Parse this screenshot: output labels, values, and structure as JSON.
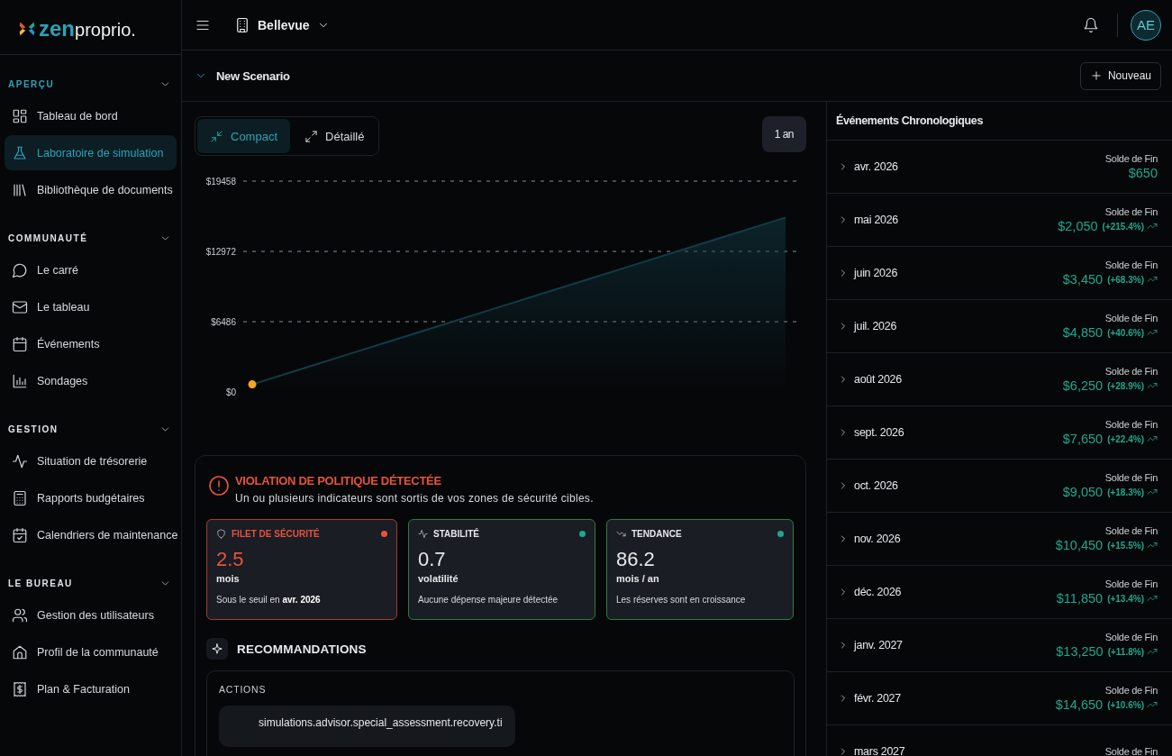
{
  "logo": {
    "part_1": "zen",
    "part_2": "proprio",
    "part_3": "."
  },
  "sidebar": {
    "sections": [
      {
        "title": "APERÇU",
        "expanded": true,
        "items": [
          {
            "label": "Tableau de bord",
            "selected": false
          },
          {
            "label": "Laboratoire de simulation",
            "selected": true
          },
          {
            "label": "Bibliothèque de documents",
            "selected": false
          }
        ]
      },
      {
        "title": "COMMUNAUTÉ",
        "expanded": true,
        "items": [
          {
            "label": "Le carré",
            "selected": false
          },
          {
            "label": "Le tableau",
            "selected": false
          },
          {
            "label": "Événements",
            "selected": false
          },
          {
            "label": "Sondages",
            "selected": false
          }
        ]
      },
      {
        "title": "GESTION",
        "expanded": true,
        "items": [
          {
            "label": "Situation de trésorerie",
            "selected": false
          },
          {
            "label": "Rapports budgétaires",
            "selected": false
          },
          {
            "label": "Calendriers de maintenance",
            "selected": false
          }
        ]
      },
      {
        "title": "LE BUREAU",
        "expanded": true,
        "items": [
          {
            "label": "Gestion des utilisateurs",
            "selected": false
          },
          {
            "label": "Profil de la communauté",
            "selected": false
          },
          {
            "label": "Plan & Facturation",
            "selected": false
          }
        ]
      }
    ]
  },
  "topbar": {
    "building": "Bellevue",
    "avatar": "AE"
  },
  "scenario": {
    "title": "New Scenario",
    "expanded": true,
    "new_button": "Nouveau"
  },
  "view_toggle": [
    {
      "label": "Compact",
      "selected": true
    },
    {
      "label": "Détaillé",
      "selected": false
    }
  ],
  "period_button": "1 an",
  "chart_data": {
    "type": "area",
    "values": [
      700,
      2100,
      3500,
      4900,
      6300,
      7700,
      9100,
      10500,
      11900,
      13300,
      14700,
      16100
    ],
    "ylim": [
      0,
      19458
    ],
    "yticks": [
      {
        "value": 0,
        "label": "$0"
      },
      {
        "value": 6486,
        "label": "$6486"
      },
      {
        "value": 12972,
        "label": "$12972"
      },
      {
        "value": 19458,
        "label": "$19458"
      }
    ]
  },
  "alert": {
    "title": "VIOLATION DE POLITIQUE DÉTECTÉE",
    "message": "Un ou plusieurs indicateurs sont sortis de vos zones de sécurité cibles."
  },
  "metrics": [
    {
      "title": "FILET DE SÉCURITÉ",
      "kind": "alert",
      "color": "#e5533c",
      "value": "2.5",
      "unit": "mois",
      "note": "Sous le seuil en **avr. 2026**"
    },
    {
      "title": "STABILITÉ",
      "kind": "ok",
      "color": "#1fa88e",
      "value": "0.7",
      "unit": "volatilité",
      "note": "Aucune dépense majeure détectée"
    },
    {
      "title": "TENDANCE",
      "kind": "ok",
      "color": "#1fa88e",
      "value": "86.2",
      "unit": "mois / an",
      "note": "Les réserves sont en croissance"
    }
  ],
  "recommendations": {
    "title": "RECOMMANDATIONS",
    "actions_label": "ACTIONS",
    "actions": [
      "simulations.advisor.special_assessment.recovery.ti"
    ]
  },
  "timeline": {
    "title": "Événements Chronologiques",
    "rows": [
      {
        "month": "avr. 2026",
        "label": "Solde de Fin",
        "amount": "$650"
      },
      {
        "month": "mai 2026",
        "label": "Solde de Fin",
        "amount": "$2,050",
        "change": "(+215.4%)"
      },
      {
        "month": "juin 2026",
        "label": "Solde de Fin",
        "amount": "$3,450",
        "change": "(+68.3%)"
      },
      {
        "month": "juil. 2026",
        "label": "Solde de Fin",
        "amount": "$4,850",
        "change": "(+40.6%)"
      },
      {
        "month": "août 2026",
        "label": "Solde de Fin",
        "amount": "$6,250",
        "change": "(+28.9%)"
      },
      {
        "month": "sept. 2026",
        "label": "Solde de Fin",
        "amount": "$7,650",
        "change": "(+22.4%)"
      },
      {
        "month": "oct. 2026",
        "label": "Solde de Fin",
        "amount": "$9,050",
        "change": "(+18.3%)"
      },
      {
        "month": "nov. 2026",
        "label": "Solde de Fin",
        "amount": "$10,450",
        "change": "(+15.5%)"
      },
      {
        "month": "déc. 2026",
        "label": "Solde de Fin",
        "amount": "$11,850",
        "change": "(+13.4%)"
      },
      {
        "month": "janv. 2027",
        "label": "Solde de Fin",
        "amount": "$13,250",
        "change": "(+11.8%)"
      },
      {
        "month": "févr. 2027",
        "label": "Solde de Fin",
        "amount": "$14,650",
        "change": "(+10.6%)"
      },
      {
        "month": "mars 2027",
        "label": "Solde de Fin"
      }
    ]
  }
}
